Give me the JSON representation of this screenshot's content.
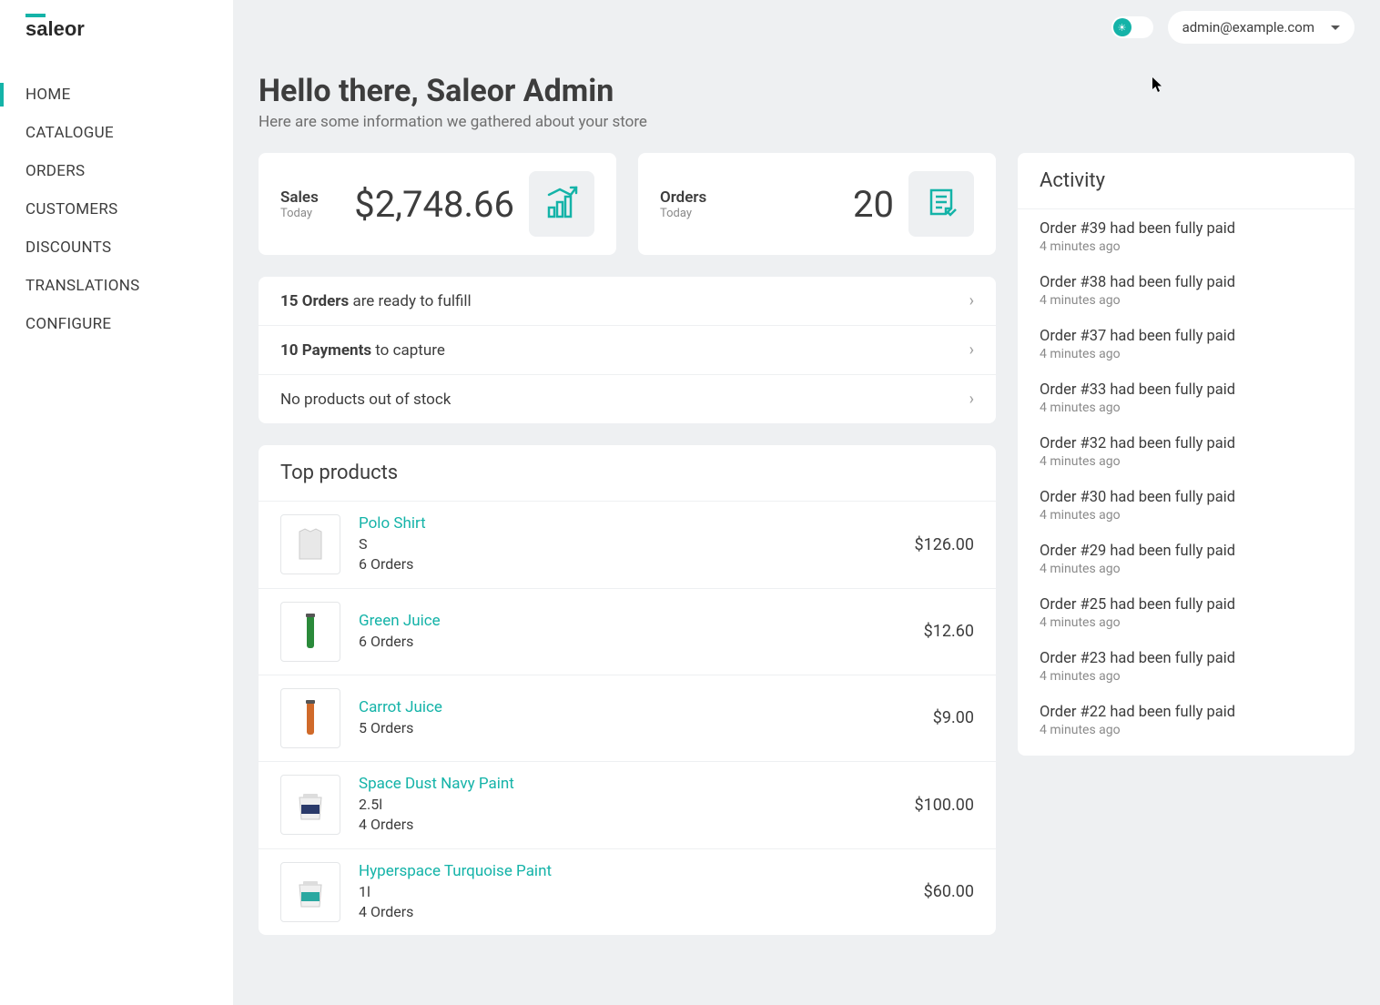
{
  "brand": "saleor",
  "user_email": "admin@example.com",
  "nav": {
    "items": [
      {
        "label": "HOME",
        "active": true
      },
      {
        "label": "CATALOGUE",
        "active": false
      },
      {
        "label": "ORDERS",
        "active": false
      },
      {
        "label": "CUSTOMERS",
        "active": false
      },
      {
        "label": "DISCOUNTS",
        "active": false
      },
      {
        "label": "TRANSLATIONS",
        "active": false
      },
      {
        "label": "CONFIGURE",
        "active": false
      }
    ]
  },
  "header": {
    "title": "Hello there, Saleor Admin",
    "subtitle": "Here are some information we gathered about your store"
  },
  "stats": {
    "sales": {
      "label": "Sales",
      "period": "Today",
      "value": "$2,748.66"
    },
    "orders": {
      "label": "Orders",
      "period": "Today",
      "value": "20"
    }
  },
  "action_rows": [
    {
      "strong": "15 Orders",
      "rest": " are ready to fulfill"
    },
    {
      "strong": "10 Payments",
      "rest": " to capture"
    },
    {
      "strong": "",
      "rest": "No products out of stock"
    }
  ],
  "top_products": {
    "title": "Top products",
    "items": [
      {
        "name": "Polo Shirt",
        "variant": "S",
        "orders": "6 Orders",
        "price": "$126.00",
        "color": "#d8d8d8"
      },
      {
        "name": "Green Juice",
        "variant": "",
        "orders": "6 Orders",
        "price": "$12.60",
        "color": "#2a8a3a"
      },
      {
        "name": "Carrot Juice",
        "variant": "",
        "orders": "5 Orders",
        "price": "$9.00",
        "color": "#d06a2a"
      },
      {
        "name": "Space Dust Navy Paint",
        "variant": "2.5l",
        "orders": "4 Orders",
        "price": "$100.00",
        "color": "#2a3a6a"
      },
      {
        "name": "Hyperspace Turquoise Paint",
        "variant": "1l",
        "orders": "4 Orders",
        "price": "$60.00",
        "color": "#2aa8a0"
      }
    ]
  },
  "activity": {
    "title": "Activity",
    "items": [
      {
        "text": "Order #39 had been fully paid",
        "time": "4 minutes ago"
      },
      {
        "text": "Order #38 had been fully paid",
        "time": "4 minutes ago"
      },
      {
        "text": "Order #37 had been fully paid",
        "time": "4 minutes ago"
      },
      {
        "text": "Order #33 had been fully paid",
        "time": "4 minutes ago"
      },
      {
        "text": "Order #32 had been fully paid",
        "time": "4 minutes ago"
      },
      {
        "text": "Order #30 had been fully paid",
        "time": "4 minutes ago"
      },
      {
        "text": "Order #29 had been fully paid",
        "time": "4 minutes ago"
      },
      {
        "text": "Order #25 had been fully paid",
        "time": "4 minutes ago"
      },
      {
        "text": "Order #23 had been fully paid",
        "time": "4 minutes ago"
      },
      {
        "text": "Order #22 had been fully paid",
        "time": "4 minutes ago"
      }
    ]
  }
}
